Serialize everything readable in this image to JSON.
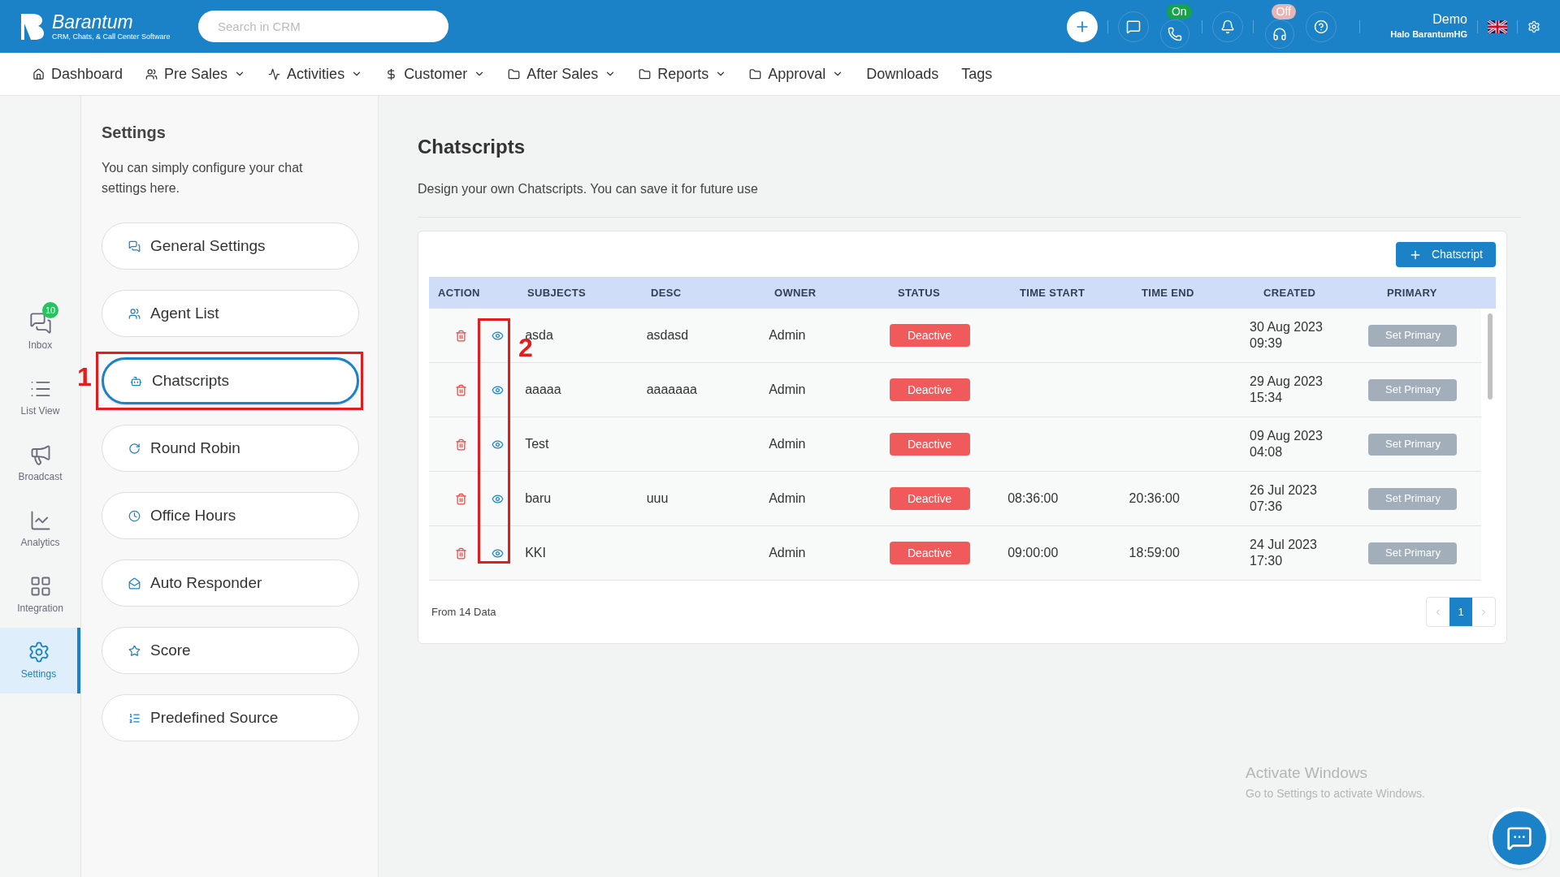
{
  "header": {
    "brand": "Barantum",
    "tagline": "CRM, Chats, & Call Center Software",
    "search": {
      "placeholder": "Search in CRM"
    },
    "phone_status": "On",
    "softphone_status": "Off",
    "user": {
      "name": "Demo",
      "company": "Halo BarantumHG"
    }
  },
  "nav": [
    {
      "label": "Dashboard",
      "kind": "home",
      "dropdown": false
    },
    {
      "label": "Pre Sales",
      "kind": "users",
      "dropdown": true
    },
    {
      "label": "Activities",
      "kind": "activity",
      "dropdown": true
    },
    {
      "label": "Customer",
      "kind": "dollar",
      "dropdown": true
    },
    {
      "label": "After Sales",
      "kind": "folder",
      "dropdown": true
    },
    {
      "label": "Reports",
      "kind": "folder",
      "dropdown": true
    },
    {
      "label": "Approval",
      "kind": "folder",
      "dropdown": true
    },
    {
      "label": "Downloads",
      "kind": "none",
      "dropdown": false
    },
    {
      "label": "Tags",
      "kind": "none",
      "dropdown": false
    }
  ],
  "rail": [
    {
      "label": "Inbox",
      "kind": "inbox",
      "badge": "10",
      "selected": false
    },
    {
      "label": "List View",
      "kind": "list",
      "selected": false
    },
    {
      "label": "Broadcast",
      "kind": "broadcast",
      "selected": false
    },
    {
      "label": "Analytics",
      "kind": "analytics",
      "selected": false
    },
    {
      "label": "Integration",
      "kind": "integration",
      "selected": false
    },
    {
      "label": "Settings",
      "kind": "settings",
      "selected": true
    }
  ],
  "settings": {
    "title": "Settings",
    "description": "You can simply configure your chat settings here.",
    "items": [
      {
        "label": "General Settings",
        "kind": "general",
        "selected": false
      },
      {
        "label": "Agent List",
        "kind": "agents",
        "selected": false
      },
      {
        "label": "Chatscripts",
        "kind": "bot",
        "selected": true,
        "annotation": "1"
      },
      {
        "label": "Round Robin",
        "kind": "robin",
        "selected": false
      },
      {
        "label": "Office Hours",
        "kind": "clock",
        "selected": false
      },
      {
        "label": "Auto Responder",
        "kind": "responder",
        "selected": false
      },
      {
        "label": "Score",
        "kind": "star",
        "selected": false
      },
      {
        "label": "Predefined Source",
        "kind": "source",
        "selected": false
      }
    ]
  },
  "page": {
    "title": "Chatscripts",
    "description": "Design your own Chatscripts. You can save it for future use",
    "add_button": "Chatscript",
    "table": {
      "columns": [
        "ACTION",
        "SUBJECTS",
        "DESC",
        "OWNER",
        "STATUS",
        "TIME START",
        "TIME END",
        "CREATED",
        "PRIMARY"
      ],
      "view_annotation": "2",
      "rows": [
        {
          "subject": "asda",
          "desc": "asdasd",
          "owner": "Admin",
          "status": "Deactive",
          "time_start": "",
          "time_end": "",
          "created_date": "30 Aug 2023",
          "created_time": "09:39",
          "primary": "Set Primary"
        },
        {
          "subject": "aaaaa",
          "desc": "aaaaaaa",
          "owner": "Admin",
          "status": "Deactive",
          "time_start": "",
          "time_end": "",
          "created_date": "29 Aug 2023",
          "created_time": "15:34",
          "primary": "Set Primary"
        },
        {
          "subject": "Test",
          "desc": "",
          "owner": "Admin",
          "status": "Deactive",
          "time_start": "",
          "time_end": "",
          "created_date": "09 Aug 2023",
          "created_time": "04:08",
          "primary": "Set Primary"
        },
        {
          "subject": "baru",
          "desc": "uuu",
          "owner": "Admin",
          "status": "Deactive",
          "time_start": "08:36:00",
          "time_end": "20:36:00",
          "created_date": "26 Jul 2023",
          "created_time": "07:36",
          "primary": "Set Primary"
        },
        {
          "subject": "KKI",
          "desc": "",
          "owner": "Admin",
          "status": "Deactive",
          "time_start": "09:00:00",
          "time_end": "18:59:00",
          "created_date": "24 Jul 2023",
          "created_time": "17:30",
          "primary": "Set Primary"
        }
      ]
    },
    "footer_count": "From 14 Data",
    "pagination": [
      {
        "label": "1",
        "selected": true
      }
    ]
  },
  "os_notice": {
    "title": "Activate Windows",
    "subtitle": "Go to Settings to activate Windows."
  }
}
